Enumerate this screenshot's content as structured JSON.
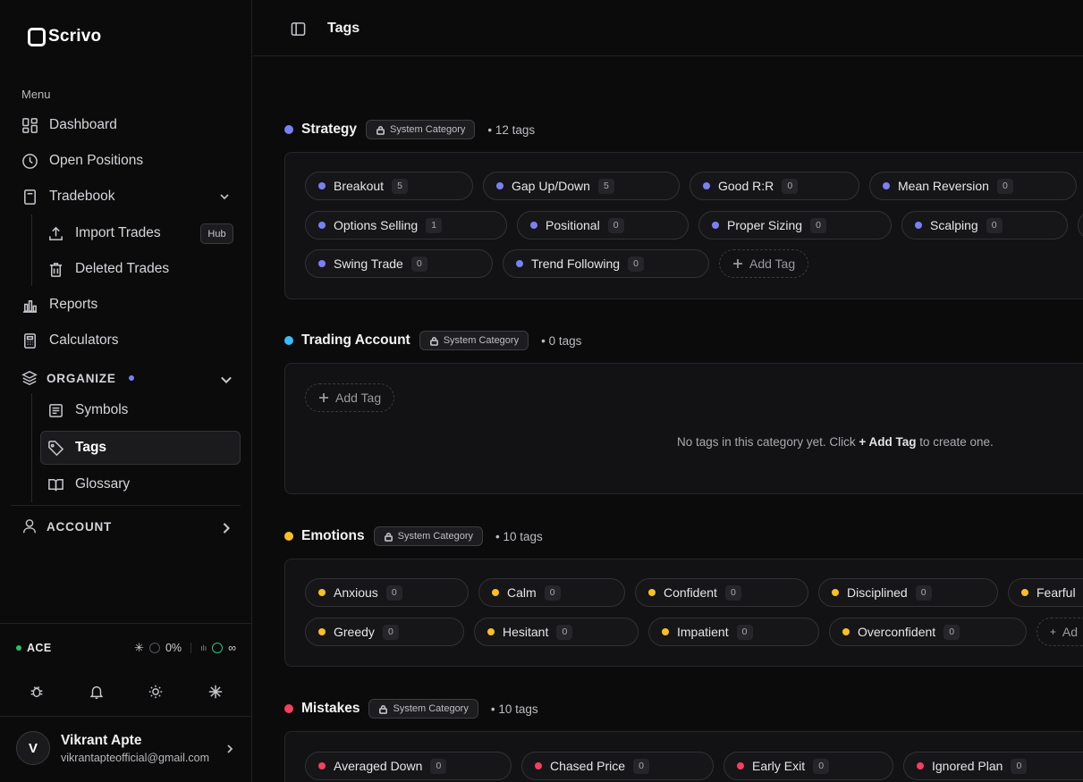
{
  "app": {
    "name": "Scrivo"
  },
  "sidebar": {
    "menu_title": "Menu",
    "items": {
      "dashboard": "Dashboard",
      "open_positions": "Open Positions",
      "tradebook": "Tradebook",
      "import_trades": "Import Trades",
      "hub_badge": "Hub",
      "deleted_trades": "Deleted Trades",
      "reports": "Reports",
      "calculators": "Calculators",
      "organize": "ORGANIZE",
      "symbols": "Symbols",
      "tags": "Tags",
      "glossary": "Glossary",
      "account": "ACCOUNT"
    },
    "status": {
      "plan": "ACE",
      "usage": "0%",
      "limit": "∞"
    },
    "user": {
      "initial": "V",
      "name": "Vikrant Apte",
      "email": "vikrantapteofficial@gmail.com"
    }
  },
  "header": {
    "title": "Tags"
  },
  "labels": {
    "system_category": "System Category",
    "add_tag": "Add Tag"
  },
  "categories": {
    "strategy": {
      "name": "Strategy",
      "count_text": "• 12 tags",
      "color": "#7b7ff5",
      "tags": [
        {
          "label": "Breakout",
          "count": "5"
        },
        {
          "label": "Gap Up/Down",
          "count": "5"
        },
        {
          "label": "Good R:R",
          "count": "0"
        },
        {
          "label": "Mean Reversion",
          "count": "0"
        },
        {
          "label": "Options Selling",
          "count": "1"
        },
        {
          "label": "Positional",
          "count": "0"
        },
        {
          "label": "Proper Sizing",
          "count": "0"
        },
        {
          "label": "Scalping",
          "count": "0"
        },
        {
          "label": "Swing Trade",
          "count": "0"
        },
        {
          "label": "Trend Following",
          "count": "0"
        }
      ]
    },
    "trading_account": {
      "name": "Trading Account",
      "count_text": "• 0 tags",
      "color": "#38bdf8",
      "empty_prefix": "No tags in this category yet. Click ",
      "empty_action": "+ Add Tag",
      "empty_suffix": " to create one."
    },
    "emotions": {
      "name": "Emotions",
      "count_text": "• 10 tags",
      "color": "#fbbf24",
      "tags": [
        {
          "label": "Anxious",
          "count": "0"
        },
        {
          "label": "Calm",
          "count": "0"
        },
        {
          "label": "Confident",
          "count": "0"
        },
        {
          "label": "Disciplined",
          "count": "0"
        },
        {
          "label": "Fearful",
          "count": ""
        },
        {
          "label": "Greedy",
          "count": "0"
        },
        {
          "label": "Hesitant",
          "count": "0"
        },
        {
          "label": "Impatient",
          "count": "0"
        },
        {
          "label": "Overconfident",
          "count": "0"
        }
      ],
      "add_partial": "Ad"
    },
    "mistakes": {
      "name": "Mistakes",
      "count_text": "• 10 tags",
      "color": "#f43f5e",
      "tags": [
        {
          "label": "Averaged Down",
          "count": "0"
        },
        {
          "label": "Chased Price",
          "count": "0"
        },
        {
          "label": "Early Exit",
          "count": "0"
        },
        {
          "label": "Ignored Plan",
          "count": "0"
        }
      ]
    }
  }
}
